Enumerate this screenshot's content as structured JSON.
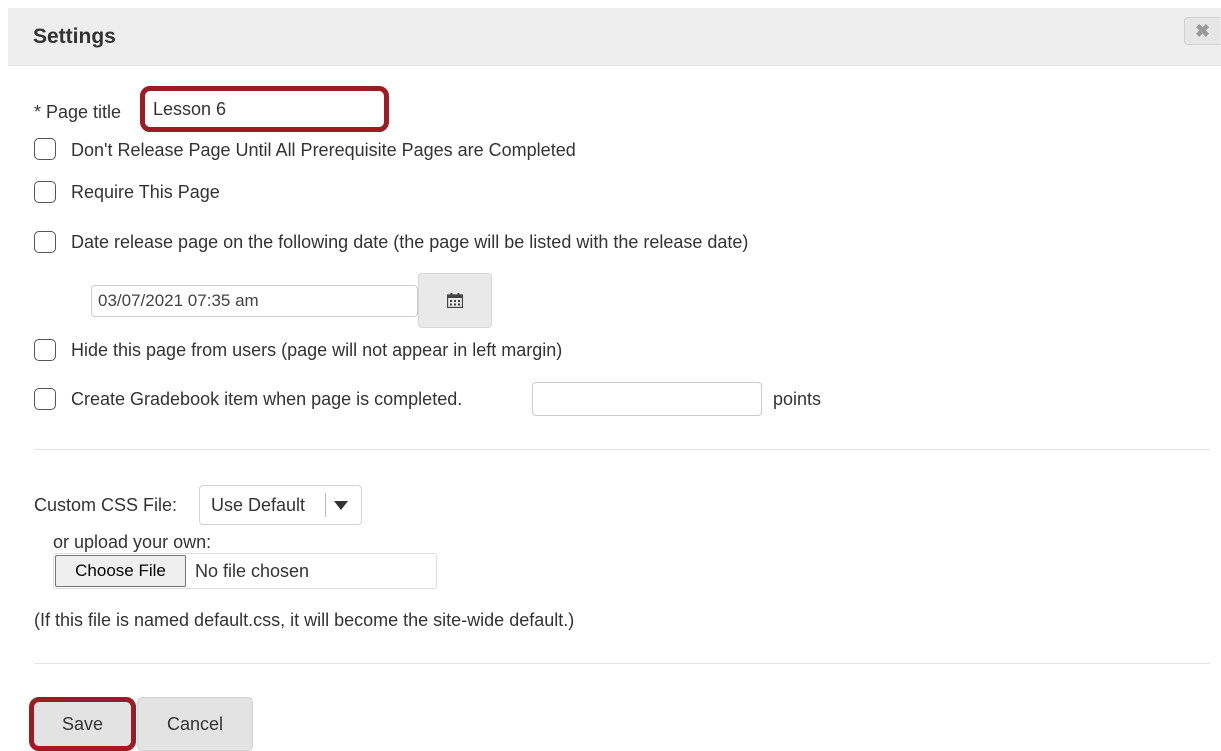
{
  "header": {
    "title": "Settings",
    "close_glyph": "✖"
  },
  "page_title": {
    "label": "* Page title",
    "value": "Lesson 6"
  },
  "options": [
    {
      "label": "Don't Release Page Until All Prerequisite Pages are Completed",
      "checked": false
    },
    {
      "label": "Require This Page",
      "checked": false
    },
    {
      "label": "Date release page on the following date (the page will be listed with the release date)",
      "checked": false
    },
    {
      "label": "Hide this page from users (page will not appear in left margin)",
      "checked": false
    },
    {
      "label": "Create Gradebook item when page is completed.",
      "checked": false
    }
  ],
  "release_date": {
    "value": "03/07/2021 07:35 am",
    "calendar_icon": "calendar-icon"
  },
  "gradebook": {
    "points_value": "",
    "points_label": "points"
  },
  "css": {
    "label": "Custom CSS File:",
    "selected": "Use Default",
    "upload_label": "or upload your own:",
    "choose_file_label": "Choose File",
    "file_status": "No file chosen",
    "note": "(If this file is named default.css, it will become the site-wide default.)"
  },
  "actions": {
    "save_label": "Save",
    "cancel_label": "Cancel"
  },
  "colors": {
    "highlight": "#9e1b22",
    "header_bg": "#eeeeee",
    "button_bg": "#e3e3e3"
  }
}
